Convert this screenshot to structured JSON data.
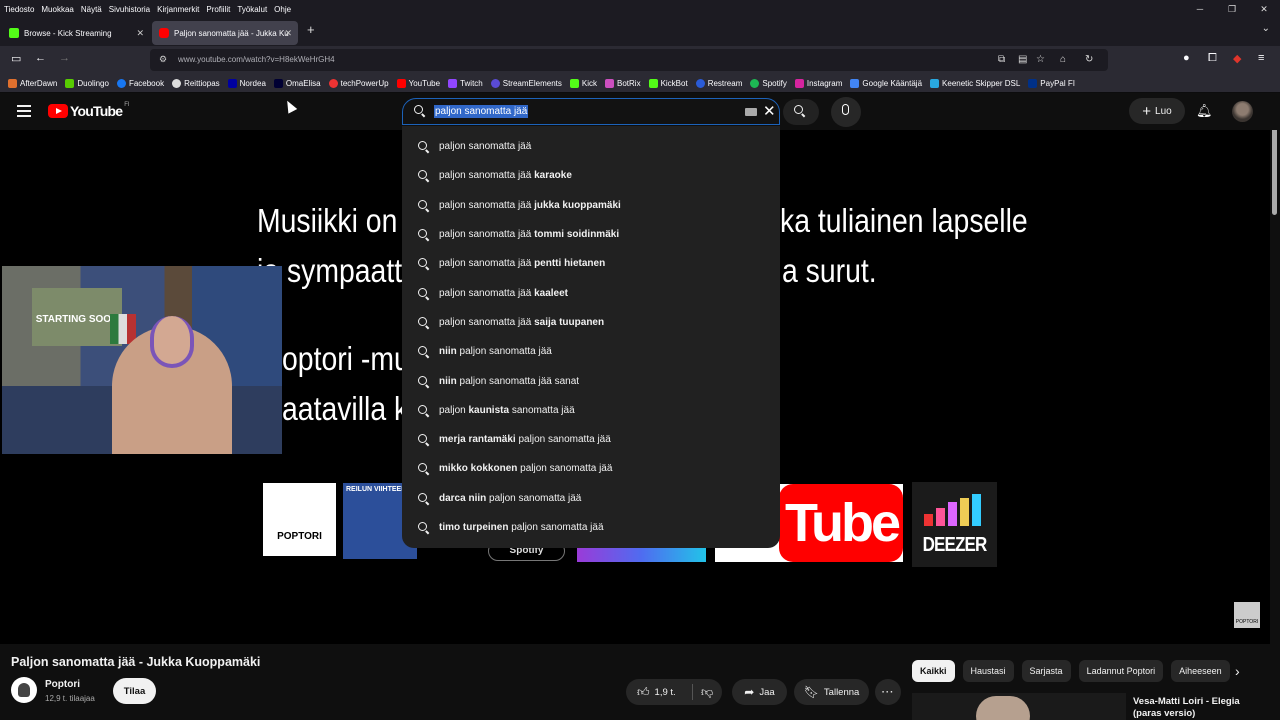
{
  "menu": [
    "Tiedosto",
    "Muokkaa",
    "Näytä",
    "Sivuhistoria",
    "Kirjanmerkit",
    "Profiilit",
    "Työkalut",
    "Ohje"
  ],
  "tabs": [
    {
      "label": "Browse - Kick Streaming",
      "color": "#53fc18"
    },
    {
      "label": "Paljon sanomatta jää - Jukka Ku",
      "color": "#ff0000"
    }
  ],
  "url": "www.youtube.com/watch?v=H8ekWeHrGH4",
  "bookmarks": [
    "AfterDawn",
    "Duolingo",
    "Facebook",
    "Reittiopas",
    "Nordea",
    "OmaElisa",
    "techPowerUp",
    "YouTube",
    "Twitch",
    "StreamElements",
    "Kick",
    "BotRix",
    "KickBot",
    "Restream",
    "Spotify",
    "Instagram",
    "Google Kääntäjä",
    "Keenetic Skipper DSL",
    "PayPal FI"
  ],
  "youtube": {
    "logo_text": "YouTube",
    "region": "FI",
    "search_query": "paljon sanomatta jää",
    "create_label": "Luo"
  },
  "suggestions": [
    {
      "pre": "paljon sanomatta jää",
      "bold": "",
      "post": ""
    },
    {
      "pre": "paljon sanomatta jää ",
      "bold": "karaoke",
      "post": ""
    },
    {
      "pre": "paljon sanomatta jää ",
      "bold": "jukka kuoppamäki",
      "post": ""
    },
    {
      "pre": "paljon sanomatta jää ",
      "bold": "tommi soidinmäki",
      "post": ""
    },
    {
      "pre": "paljon sanomatta jää ",
      "bold": "pentti hietanen",
      "post": ""
    },
    {
      "pre": "paljon sanomatta jää ",
      "bold": "kaaleet",
      "post": ""
    },
    {
      "pre": "paljon sanomatta jää ",
      "bold": "saija tuupanen",
      "post": ""
    },
    {
      "pre": "",
      "bold": "niin",
      "post": " paljon sanomatta jää"
    },
    {
      "pre": "",
      "bold": "niin",
      "post": " paljon sanomatta jää sanat"
    },
    {
      "pre": "paljon ",
      "bold": "kaunista",
      "post": " sanomatta jää"
    },
    {
      "pre": "",
      "bold": "merja rantamäki",
      "post": " paljon sanomatta jää"
    },
    {
      "pre": "",
      "bold": "mikko kokkonen",
      "post": " paljon sanomatta jää"
    },
    {
      "pre": "",
      "bold": "darca niin",
      "post": " paljon sanomatta jää"
    },
    {
      "pre": "",
      "bold": "timo turpeinen",
      "post": " paljon sanomatta jää"
    }
  ],
  "video_overlay": {
    "line1_left": "Musiikki on",
    "line1_right": "ka tuliainen lapselle",
    "line2_left": "ja sympaatt",
    "line2_right": "a surut.",
    "line3": "optori -mu",
    "line4": "aatavilla k",
    "webcam_text": "STARTING SOON",
    "logos": {
      "poptori": "POPTORI",
      "reilun": "REILUN VIIHTEEN",
      "spotify": "Spotify",
      "youtube": "Tube",
      "deezer": "DEEZER",
      "corner": "POPTORI"
    }
  },
  "video": {
    "title": "Paljon sanomatta jää - Jukka Kuoppamäki",
    "channel": "Poptori",
    "subscribers": "12,9 t. tilaajaa",
    "subscribe_label": "Tilaa",
    "likes": "1,9 t.",
    "share_label": "Jaa",
    "save_label": "Tallenna"
  },
  "chips": [
    "Kaikki",
    "Haustasi",
    "Sarjasta",
    "Ladannut Poptori",
    "Aiheeseen"
  ],
  "related": {
    "title": "Vesa-Matti Loiri - Elegia (paras versio)"
  }
}
